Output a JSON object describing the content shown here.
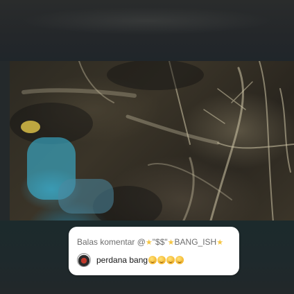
{
  "comment": {
    "reply_prefix": "Balas komentar @",
    "reply_user_part1": "\"$$\"",
    "reply_user_part2": "BANG_ISH",
    "text": "perdana bang",
    "emoji_names": [
      "grinning-face-icon",
      "grinning-face-icon",
      "grinning-face-icon",
      "hand-over-mouth-icon"
    ]
  },
  "colors": {
    "card_bg": "#ffffff",
    "star": "#f5c542",
    "video_tone": "#3a3428"
  }
}
